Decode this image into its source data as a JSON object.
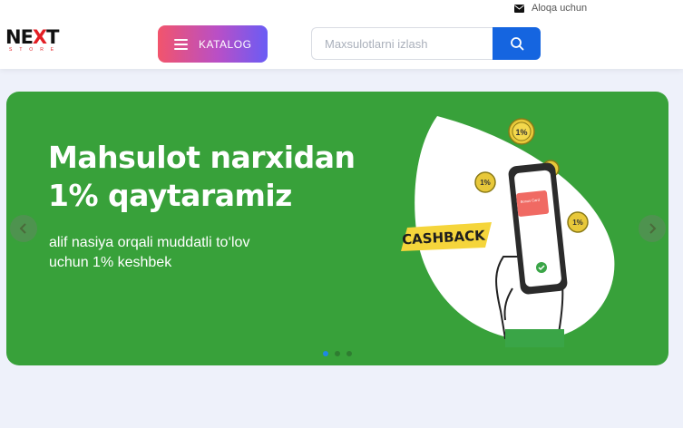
{
  "header": {
    "contact_label": "Aloqa uchun",
    "logo": {
      "text_a": "NE",
      "text_x": "X",
      "text_b": "T",
      "subtitle": "STORE"
    },
    "catalog_label": "KATALOG",
    "search": {
      "placeholder": "Maxsulotlarni izlash",
      "value": ""
    }
  },
  "banner": {
    "title_line1": "Mahsulot narxidan",
    "title_line2": "1% qaytaramiz",
    "subtitle_line1": "alif nasiya orqali muddatli to‘lov",
    "subtitle_line2": "uchun 1% keshbek",
    "cashback_label": "CASHBACK",
    "coin_label": "1%",
    "card_label": "Bonus Card",
    "background_color": "#38a13a",
    "slides_count": 3,
    "active_slide": 0
  },
  "colors": {
    "accent_blue": "#1565e0",
    "catalog_gradient": [
      "#f2546c",
      "#6a5cf5"
    ],
    "cashback_yellow": "#f5d53b"
  },
  "icons": {
    "contact": "envelope-icon",
    "catalog": "hamburger-menu-icon",
    "search": "search-icon",
    "prev": "chevron-left-icon",
    "next": "chevron-right-icon"
  }
}
